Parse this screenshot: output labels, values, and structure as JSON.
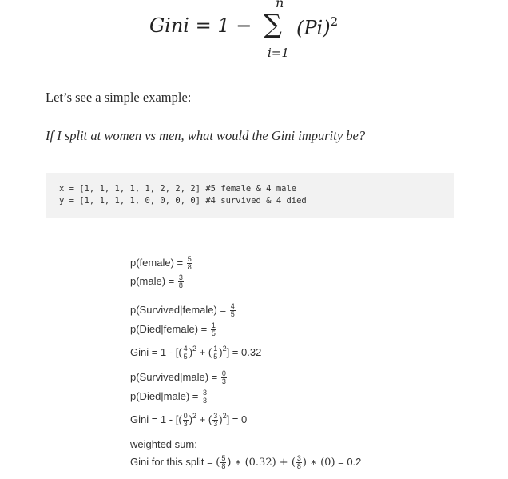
{
  "formula": {
    "lhs": "Gini = 1 −",
    "sum_upper": "n",
    "sum_symbol": "∑",
    "sum_lower": "i=1",
    "term": "(Pi)",
    "term_power": "2"
  },
  "intro": "Let’s see a simple example:",
  "question": "If I split at women vs men, what would the Gini impurity be?",
  "code_lines": [
    "x = [1, 1, 1, 1, 1, 2, 2, 2] #5 female & 4 male",
    "y = [1, 1, 1, 1, 0, 0, 0, 0] #4 survived & 4 died"
  ],
  "female_block": {
    "p_female": {
      "label": "p(female) =",
      "num": "5",
      "den": "8"
    },
    "p_male": {
      "label": "p(male) =",
      "num": "3",
      "den": "8"
    }
  },
  "survived_female": {
    "p_survived": {
      "label": "p(Survived|female) =",
      "num": "4",
      "den": "5"
    },
    "p_died": {
      "label": "p(Died|female) =",
      "num": "1",
      "den": "5"
    },
    "gini": {
      "prefix": "Gini = 1 - [(",
      "f1_num": "4",
      "f1_den": "5",
      "mid": ")",
      "plus": " + (",
      "f2_num": "1",
      "f2_den": "5",
      "end": ")",
      "power": "2",
      "result": "] = 0.32"
    }
  },
  "survived_male": {
    "p_survived": {
      "label": "p(Survived|male) =",
      "num": "0",
      "den": "3"
    },
    "p_died": {
      "label": "p(Died|male) =",
      "num": "3",
      "den": "3"
    },
    "gini": {
      "prefix": "Gini = 1 - [(",
      "f1_num": "0",
      "f1_den": "3",
      "mid": ")",
      "plus": " + (",
      "f2_num": "3",
      "f2_den": "3",
      "end": ")",
      "power": "2",
      "result": "] = 0"
    }
  },
  "weighted": {
    "heading": "weighted sum:",
    "prefix": "Gini for this split = ",
    "f1_num": "5",
    "f1_den": "8",
    "term1": " ∗ (0.32) + ",
    "f2_num": "3",
    "f2_den": "8",
    "term2": " ∗ (0)",
    "result": " = 0.2"
  }
}
